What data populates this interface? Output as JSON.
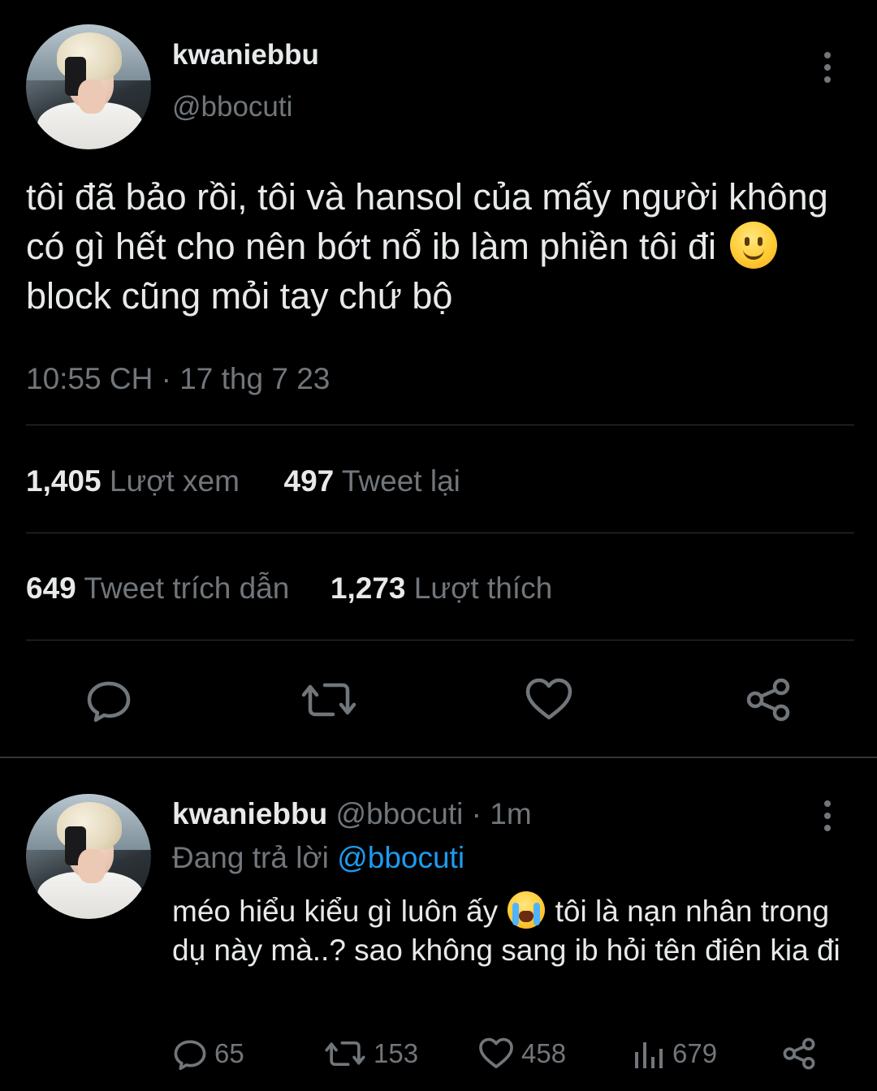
{
  "main_tweet": {
    "display_name": "kwaniebbu",
    "handle": "@bbocuti",
    "text_parts": [
      "tôi đã bảo rồi, tôi và hansol của mấy người không có gì hết cho nên bớt nổ ib làm phiền tôi đi ",
      " block cũng mỏi tay chứ bộ"
    ],
    "emoji": "slightly-smiling-face",
    "timestamp": "10:55 CH · 17 thg 7 23",
    "stats": {
      "views_count": "1,405",
      "views_label": "Lượt xem",
      "retweets_count": "497",
      "retweets_label": "Tweet lại",
      "quotes_count": "649",
      "quotes_label": "Tweet trích dẫn",
      "likes_count": "1,273",
      "likes_label": "Lượt thích"
    },
    "actions": [
      "reply-icon",
      "retweet-icon",
      "like-icon",
      "share-icon"
    ]
  },
  "reply_tweet": {
    "display_name": "kwaniebbu",
    "handle": "@bbocuti",
    "time": " · 1m",
    "replying_prefix": "Đang trả lời ",
    "replying_to": "@bbocuti",
    "text_parts": [
      "méo hiểu kiểu gì luôn ấy ",
      " tôi là nạn nhân trong dụ này mà..? sao không sang ib hỏi tên điên kia đi"
    ],
    "emoji": "loudly-crying-face",
    "actions": {
      "replies": "65",
      "retweets": "153",
      "likes": "458",
      "views": "679"
    }
  },
  "colors": {
    "background": "#000000",
    "text": "#e7e9ea",
    "muted": "#71767b",
    "accent": "#1d9bf0",
    "divider": "#2f3336"
  }
}
